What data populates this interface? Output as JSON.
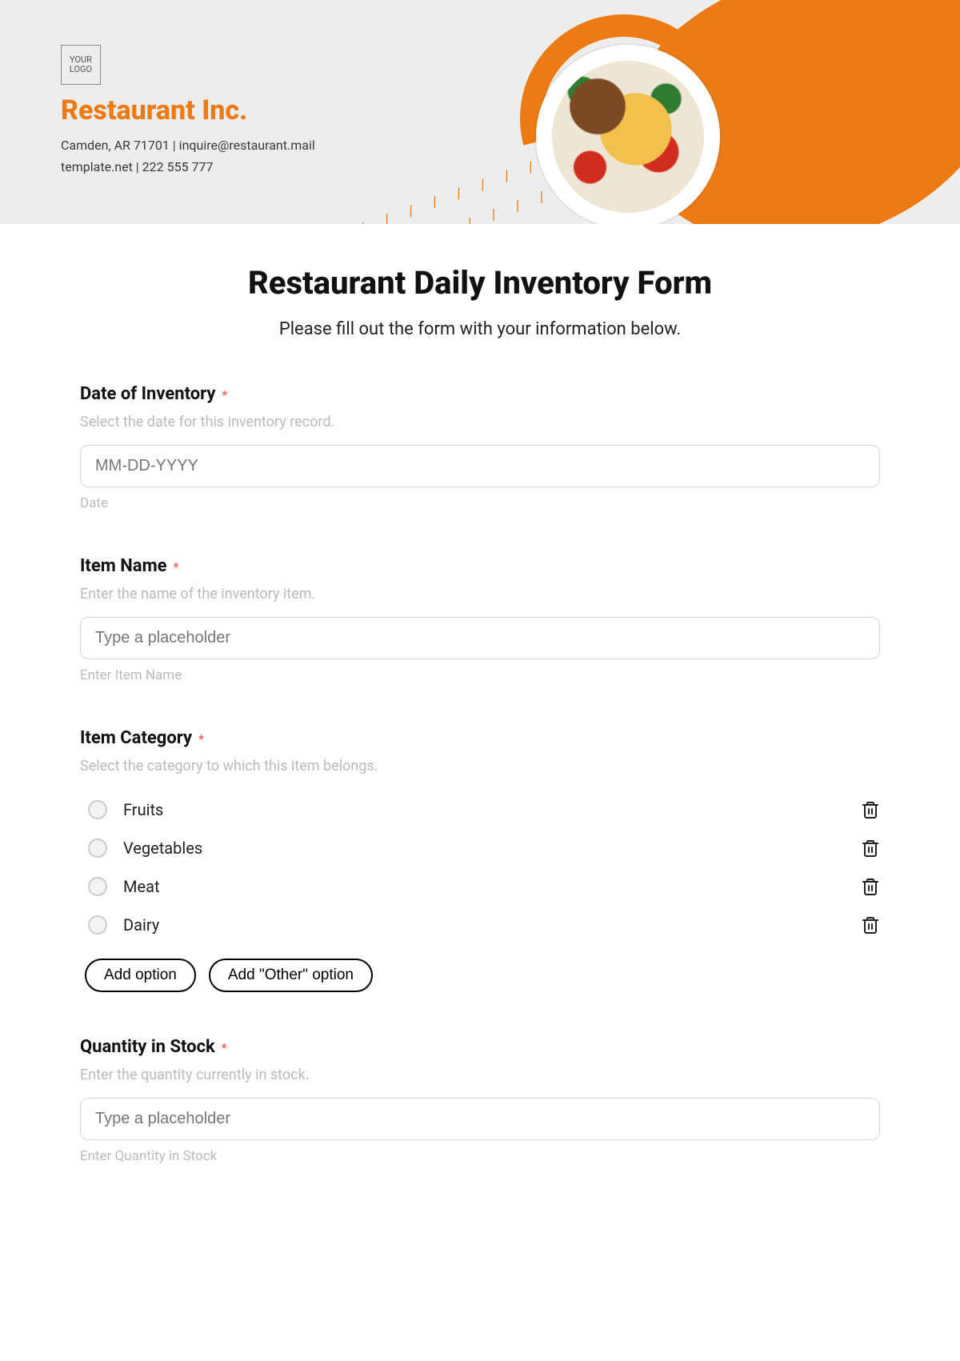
{
  "header": {
    "logo_text": "YOUR\nLOGO",
    "brand": "Restaurant Inc.",
    "address_line": "Camden, AR 71701 | inquire@restaurant.mail",
    "contact_line": "template.net | 222 555 777"
  },
  "form": {
    "title": "Restaurant Daily Inventory Form",
    "subtitle": "Please fill out the form with your information below."
  },
  "date_field": {
    "label": "Date of Inventory",
    "required_mark": "*",
    "description": "Select the date for this inventory record.",
    "placeholder": "MM-DD-YYYY",
    "under": "Date"
  },
  "item_name_field": {
    "label": "Item Name",
    "required_mark": "*",
    "description": "Enter the name of the inventory item.",
    "placeholder": "Type a placeholder",
    "under": "Enter Item Name"
  },
  "category_field": {
    "label": "Item Category",
    "required_mark": "*",
    "description": "Select the category to which this item belongs.",
    "options": [
      "Fruits",
      "Vegetables",
      "Meat",
      "Dairy"
    ],
    "add_option_label": "Add option",
    "add_other_label": "Add \"Other\" option"
  },
  "quantity_field": {
    "label": "Quantity in Stock",
    "required_mark": "*",
    "description": "Enter the quantity currently in stock.",
    "placeholder": "Type a placeholder",
    "under": "Enter Quantity in Stock"
  }
}
